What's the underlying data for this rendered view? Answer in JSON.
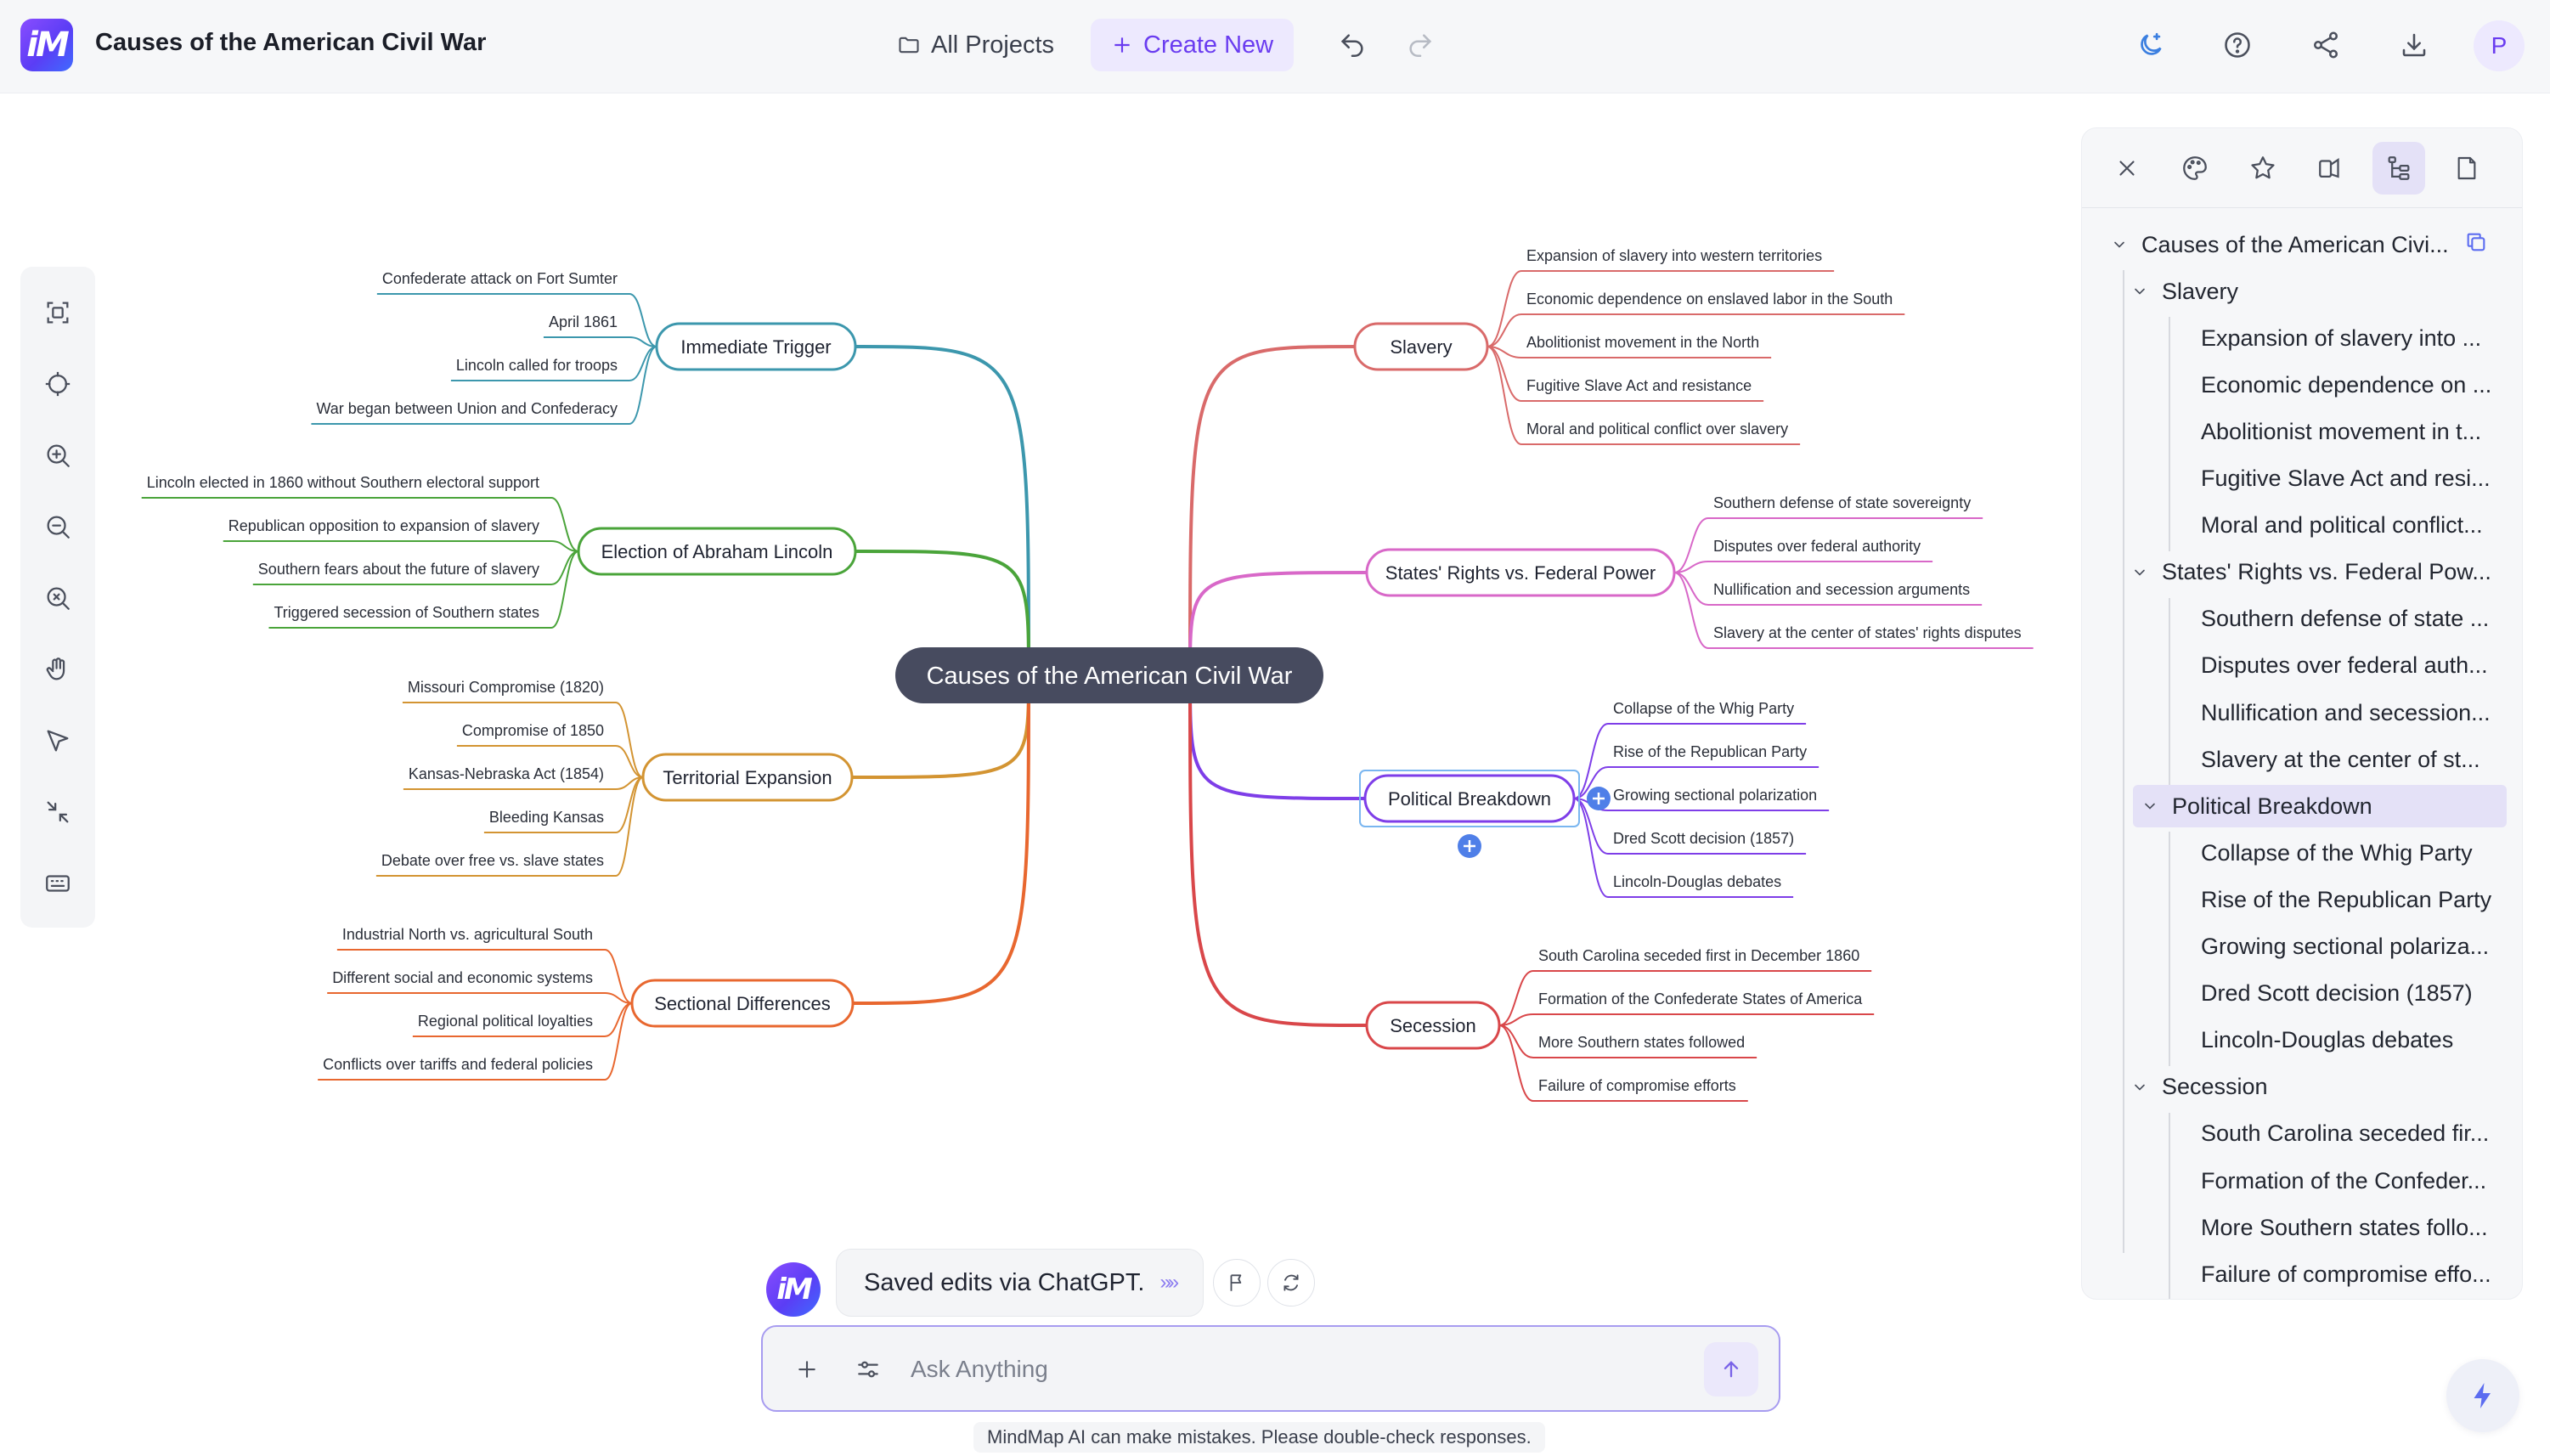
{
  "header": {
    "doc_title": "Causes of the American Civil War",
    "all_projects": "All Projects",
    "create_new": "Create New",
    "avatar_initial": "P",
    "icons": [
      "undo-icon",
      "redo-icon",
      "theme-moon-icon",
      "help-icon",
      "share-icon",
      "download-icon"
    ]
  },
  "left_toolbar": {
    "icons": [
      "fit-view-icon",
      "center-icon",
      "zoom-in-icon",
      "zoom-out-icon",
      "reset-zoom-icon",
      "hand-pan-icon",
      "select-pointer-icon",
      "collapse-icon",
      "keyboard-icon"
    ]
  },
  "map": {
    "root": "Causes of the American Civil War",
    "branches": [
      {
        "label": "Immediate Trigger",
        "side": "left",
        "color": "#3c97ad",
        "children": [
          "Confederate attack on Fort Sumter",
          "April 1861",
          "Lincoln called for troops",
          "War began between Union and Confederacy"
        ]
      },
      {
        "label": "Election of Abraham Lincoln",
        "side": "left",
        "color": "#4aa43a",
        "children": [
          "Lincoln elected in 1860 without Southern electoral support",
          "Republican opposition to expansion of slavery",
          "Southern fears about the future of slavery",
          "Triggered secession of Southern states"
        ]
      },
      {
        "label": "Territorial Expansion",
        "side": "left",
        "color": "#d39432",
        "children": [
          "Missouri Compromise (1820)",
          "Compromise of 1850",
          "Kansas-Nebraska Act (1854)",
          "Bleeding Kansas",
          "Debate over free vs. slave states"
        ]
      },
      {
        "label": "Sectional Differences",
        "side": "left",
        "color": "#e8672f",
        "children": [
          "Industrial North vs. agricultural South",
          "Different social and economic systems",
          "Regional political loyalties",
          "Conflicts over tariffs and federal policies"
        ]
      },
      {
        "label": "Slavery",
        "side": "right",
        "color": "#d96a6a",
        "children": [
          "Expansion of slavery into western territories",
          "Economic dependence on enslaved labor in the South",
          "Abolitionist movement in the North",
          "Fugitive Slave Act and resistance",
          "Moral and political conflict over slavery"
        ]
      },
      {
        "label": "States' Rights vs. Federal Power",
        "side": "right",
        "color": "#d868c8",
        "children": [
          "Southern defense of state sovereignty",
          "Disputes over federal authority",
          "Nullification and secession arguments",
          "Slavery at the center of states' rights disputes"
        ]
      },
      {
        "label": "Political Breakdown",
        "side": "right",
        "color": "#7e3ee8",
        "children": [
          "Collapse of the Whig Party",
          "Rise of the Republican Party",
          "Growing sectional polarization",
          "Dred Scott decision (1857)",
          "Lincoln-Douglas debates"
        ]
      },
      {
        "label": "Secession",
        "side": "right",
        "color": "#d9474a",
        "children": [
          "South Carolina seceded first in December 1860",
          "Formation of the Confederate States of America",
          "More Southern states followed",
          "Failure of compromise efforts"
        ]
      }
    ]
  },
  "right_panel": {
    "tabs": [
      "close-icon",
      "palette-icon",
      "star-icon",
      "layout-icon",
      "outline-tree-icon",
      "note-icon"
    ],
    "active_tab": 4,
    "outline": [
      {
        "depth": 0,
        "label": "Causes of the American Civi...",
        "expanded": true
      },
      {
        "depth": 1,
        "label": "Slavery",
        "expanded": true
      },
      {
        "depth": 2,
        "label": "Expansion of slavery into ..."
      },
      {
        "depth": 2,
        "label": "Economic dependence on ..."
      },
      {
        "depth": 2,
        "label": "Abolitionist movement in t..."
      },
      {
        "depth": 2,
        "label": "Fugitive Slave Act and resi..."
      },
      {
        "depth": 2,
        "label": "Moral and political conflict..."
      },
      {
        "depth": 1,
        "label": "States' Rights vs. Federal Pow...",
        "expanded": true
      },
      {
        "depth": 2,
        "label": "Southern defense of state ..."
      },
      {
        "depth": 2,
        "label": "Disputes over federal auth..."
      },
      {
        "depth": 2,
        "label": "Nullification and secession..."
      },
      {
        "depth": 2,
        "label": "Slavery at the center of st..."
      },
      {
        "depth": 1,
        "label": "Political Breakdown",
        "expanded": true,
        "selected": true
      },
      {
        "depth": 2,
        "label": "Collapse of the Whig Party"
      },
      {
        "depth": 2,
        "label": "Rise of the Republican Party"
      },
      {
        "depth": 2,
        "label": "Growing sectional polariza..."
      },
      {
        "depth": 2,
        "label": "Dred Scott decision (1857)"
      },
      {
        "depth": 2,
        "label": "Lincoln-Douglas debates"
      },
      {
        "depth": 1,
        "label": "Secession",
        "expanded": true
      },
      {
        "depth": 2,
        "label": "South Carolina seceded fir..."
      },
      {
        "depth": 2,
        "label": "Formation of the Confeder..."
      },
      {
        "depth": 2,
        "label": "More Southern states follo..."
      },
      {
        "depth": 2,
        "label": "Failure of compromise effo..."
      }
    ]
  },
  "chat": {
    "saved_message": "Saved edits via ChatGPT.",
    "input_placeholder": "Ask Anything",
    "disclaimer": "MindMap AI can make mistakes. Please double-check responses."
  },
  "colors": {
    "accent": "#6a3cf0",
    "root_fill": "#474b5f",
    "selected_node_ring": "#7ab6f0",
    "add_button": "#4f7fe8"
  }
}
